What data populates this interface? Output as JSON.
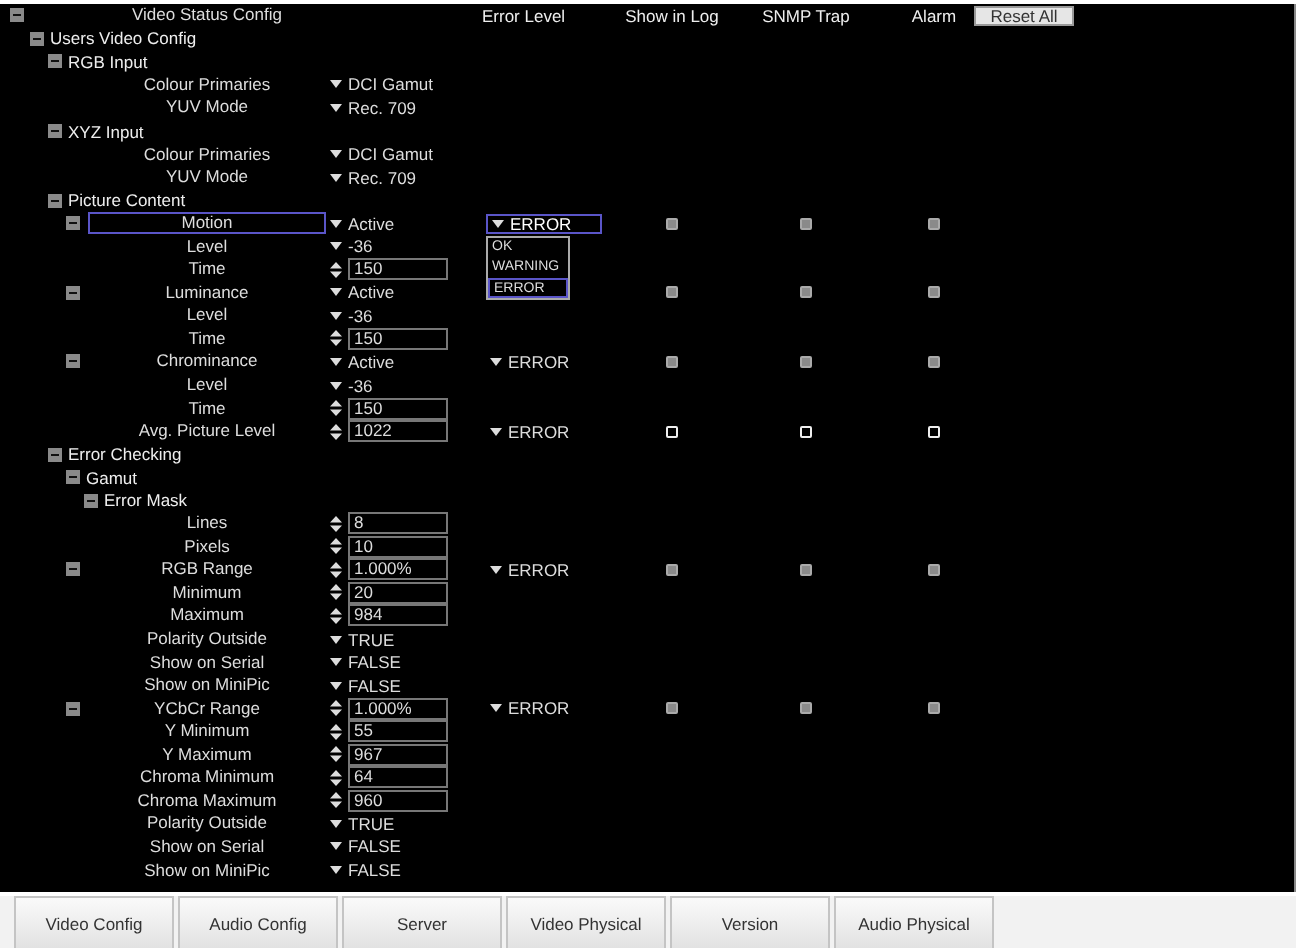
{
  "header": {
    "title": "Video Status Config",
    "columns": [
      "Error Level",
      "Show in Log",
      "SNMP Trap",
      "Alarm"
    ],
    "reset_button": "Reset All"
  },
  "tree": [
    {
      "label": "Users Video Config",
      "kind": "group",
      "expanded": true,
      "children": [
        {
          "label": "RGB Input",
          "kind": "group",
          "expanded": true,
          "children": [
            {
              "label": "Colour Primaries",
              "kind": "param",
              "value": {
                "kind": "dropdown",
                "text": "DCI Gamut"
              }
            },
            {
              "label": "YUV Mode",
              "kind": "param",
              "value": {
                "kind": "dropdown",
                "text": "Rec. 709"
              }
            }
          ]
        },
        {
          "label": "XYZ Input",
          "kind": "group",
          "expanded": true,
          "children": [
            {
              "label": "Colour Primaries",
              "kind": "param",
              "value": {
                "kind": "dropdown",
                "text": "DCI Gamut"
              }
            },
            {
              "label": "YUV Mode",
              "kind": "param",
              "value": {
                "kind": "dropdown",
                "text": "Rec. 709"
              }
            }
          ]
        },
        {
          "label": "Picture Content",
          "kind": "group",
          "expanded": true,
          "children": [
            {
              "label": "Motion",
              "kind": "param",
              "expanded": true,
              "focused": true,
              "value": {
                "kind": "dropdown",
                "text": "Active"
              },
              "error_level": {
                "text": "ERROR",
                "open": true,
                "options": [
                  {
                    "text": "OK",
                    "selected": false
                  },
                  {
                    "text": "WARNING",
                    "selected": false
                  },
                  {
                    "text": "ERROR",
                    "selected": true
                  }
                ]
              },
              "show_in_log": true,
              "snmp_trap": true,
              "alarm": true,
              "children": [
                {
                  "label": "Level",
                  "kind": "param",
                  "value": {
                    "kind": "dropdown",
                    "text": "-36"
                  }
                },
                {
                  "label": "Time",
                  "kind": "param",
                  "value": {
                    "kind": "spinner",
                    "text": "150"
                  }
                }
              ]
            },
            {
              "label": "Luminance",
              "kind": "param",
              "expanded": true,
              "focused": false,
              "value": {
                "kind": "dropdown",
                "text": "Active"
              },
              "show_in_log": true,
              "snmp_trap": true,
              "alarm": true,
              "children": [
                {
                  "label": "Level",
                  "kind": "param",
                  "value": {
                    "kind": "dropdown",
                    "text": "-36"
                  }
                },
                {
                  "label": "Time",
                  "kind": "param",
                  "value": {
                    "kind": "spinner",
                    "text": "150"
                  }
                }
              ]
            },
            {
              "label": "Chrominance",
              "kind": "param",
              "expanded": true,
              "focused": false,
              "value": {
                "kind": "dropdown",
                "text": "Active"
              },
              "error_level": {
                "text": "ERROR",
                "open": false
              },
              "show_in_log": true,
              "snmp_trap": true,
              "alarm": true,
              "children": [
                {
                  "label": "Level",
                  "kind": "param",
                  "value": {
                    "kind": "dropdown",
                    "text": "-36"
                  }
                },
                {
                  "label": "Time",
                  "kind": "param",
                  "value": {
                    "kind": "spinner",
                    "text": "150"
                  }
                }
              ]
            },
            {
              "label": "Avg. Picture Level",
              "kind": "param",
              "value": {
                "kind": "spinner",
                "text": "1022"
              },
              "error_level": {
                "text": "ERROR",
                "open": false
              },
              "show_in_log": false,
              "snmp_trap": false,
              "alarm": false
            }
          ]
        },
        {
          "label": "Error Checking",
          "kind": "group",
          "expanded": true,
          "children": [
            {
              "label": "Gamut",
              "kind": "group",
              "expanded": true,
              "children": [
                {
                  "label": "Error Mask",
                  "kind": "group",
                  "expanded": true,
                  "children": [
                    {
                      "label": "Lines",
                      "kind": "param",
                      "value": {
                        "kind": "spinner",
                        "text": "8"
                      }
                    },
                    {
                      "label": "Pixels",
                      "kind": "param",
                      "value": {
                        "kind": "spinner",
                        "text": "10"
                      }
                    },
                    {
                      "label": "RGB Range",
                      "kind": "param",
                      "expanded": true,
                      "focused": false,
                      "value": {
                        "kind": "spinner",
                        "text": "1.000%"
                      },
                      "error_level": {
                        "text": "ERROR",
                        "open": false
                      },
                      "show_in_log": true,
                      "snmp_trap": true,
                      "alarm": true,
                      "children": [
                        {
                          "label": "Minimum",
                          "kind": "param",
                          "value": {
                            "kind": "spinner",
                            "text": "20"
                          }
                        },
                        {
                          "label": "Maximum",
                          "kind": "param",
                          "value": {
                            "kind": "spinner",
                            "text": "984"
                          }
                        },
                        {
                          "label": "Polarity Outside",
                          "kind": "param",
                          "value": {
                            "kind": "dropdown",
                            "text": "TRUE"
                          }
                        },
                        {
                          "label": "Show on Serial",
                          "kind": "param",
                          "value": {
                            "kind": "dropdown",
                            "text": "FALSE"
                          }
                        },
                        {
                          "label": "Show on MiniPic",
                          "kind": "param",
                          "value": {
                            "kind": "dropdown",
                            "text": "FALSE"
                          }
                        }
                      ]
                    },
                    {
                      "label": "YCbCr Range",
                      "kind": "param",
                      "expanded": true,
                      "focused": false,
                      "value": {
                        "kind": "spinner",
                        "text": "1.000%"
                      },
                      "error_level": {
                        "text": "ERROR",
                        "open": false
                      },
                      "show_in_log": true,
                      "snmp_trap": true,
                      "alarm": true,
                      "children": [
                        {
                          "label": "Y Minimum",
                          "kind": "param",
                          "value": {
                            "kind": "spinner",
                            "text": "55"
                          }
                        },
                        {
                          "label": "Y Maximum",
                          "kind": "param",
                          "value": {
                            "kind": "spinner",
                            "text": "967"
                          }
                        },
                        {
                          "label": "Chroma Minimum",
                          "kind": "param",
                          "value": {
                            "kind": "spinner",
                            "text": "64"
                          }
                        },
                        {
                          "label": "Chroma Maximum",
                          "kind": "param",
                          "value": {
                            "kind": "spinner",
                            "text": "960"
                          }
                        },
                        {
                          "label": "Polarity Outside",
                          "kind": "param",
                          "value": {
                            "kind": "dropdown",
                            "text": "TRUE"
                          }
                        },
                        {
                          "label": "Show on Serial",
                          "kind": "param",
                          "value": {
                            "kind": "dropdown",
                            "text": "FALSE"
                          }
                        },
                        {
                          "label": "Show on MiniPic",
                          "kind": "param",
                          "value": {
                            "kind": "dropdown",
                            "text": "FALSE"
                          }
                        }
                      ]
                    }
                  ]
                }
              ]
            }
          ]
        }
      ]
    }
  ],
  "tabs": [
    "Video Config",
    "Audio Config",
    "Server",
    "Video Physical",
    "Version",
    "Audio Physical"
  ]
}
